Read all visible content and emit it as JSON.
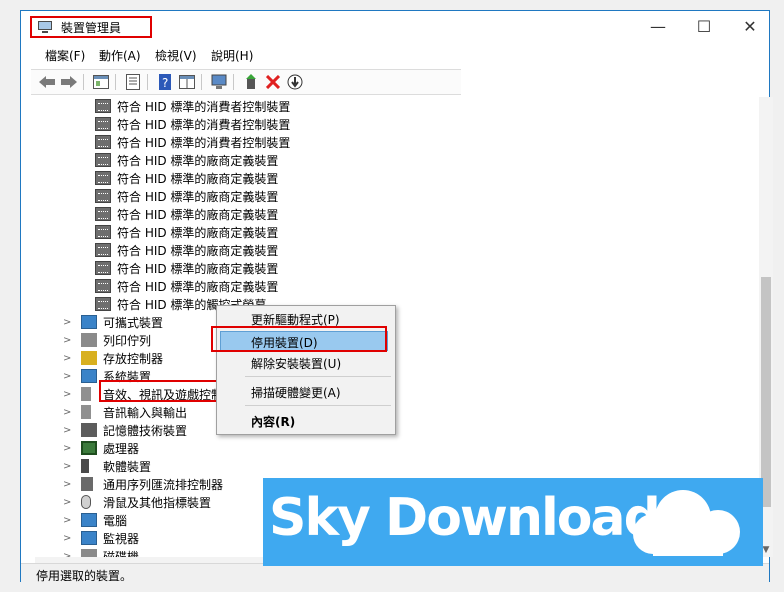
{
  "window": {
    "title": "裝置管理員",
    "controls": {
      "minimize": "—",
      "maximize": "☐",
      "close": "✕"
    }
  },
  "menu": [
    "檔案(F)",
    "動作(A)",
    "檢視(V)",
    "說明(H)"
  ],
  "toolbar": [
    "back",
    "forward",
    "properties",
    "show-hidden",
    "help",
    "view",
    "computer",
    "add-driver",
    "uninstall",
    "update"
  ],
  "tree": {
    "hid_items": [
      "符合 HID 標準的消費者控制裝置",
      "符合 HID 標準的消費者控制裝置",
      "符合 HID 標準的消費者控制裝置",
      "符合 HID 標準的廠商定義裝置",
      "符合 HID 標準的廠商定義裝置",
      "符合 HID 標準的廠商定義裝置",
      "符合 HID 標準的廠商定義裝置",
      "符合 HID 標準的廠商定義裝置",
      "符合 HID 標準的廠商定義裝置",
      "符合 HID 標準的廠商定義裝置",
      "符合 HID 標準的廠商定義裝置",
      "符合 HID 標準的觸控式螢幕"
    ],
    "categories": [
      "可攜式裝置",
      "列印佇列",
      "存放控制器",
      "系統裝置",
      "音效、視訊及遊戲控制器",
      "音訊輸入與輸出",
      "記憶體技術裝置",
      "處理器",
      "軟體裝置",
      "通用序列匯流排控制器",
      "滑鼠及其他指標裝置",
      "電腦",
      "監視器",
      "磁碟機"
    ]
  },
  "context_menu": {
    "update_driver": "更新驅動程式(P)",
    "disable_device": "停用裝置(D)",
    "uninstall_device": "解除安裝裝置(U)",
    "scan_hardware": "掃描硬體變更(A)",
    "properties": "內容(R)"
  },
  "status": "停用選取的裝置。",
  "watermark": "Sky Download",
  "colors": {
    "highlight_box": "#e00000",
    "menu_highlight": "#99c9ef",
    "watermark_bg": "#3fa9f0"
  }
}
